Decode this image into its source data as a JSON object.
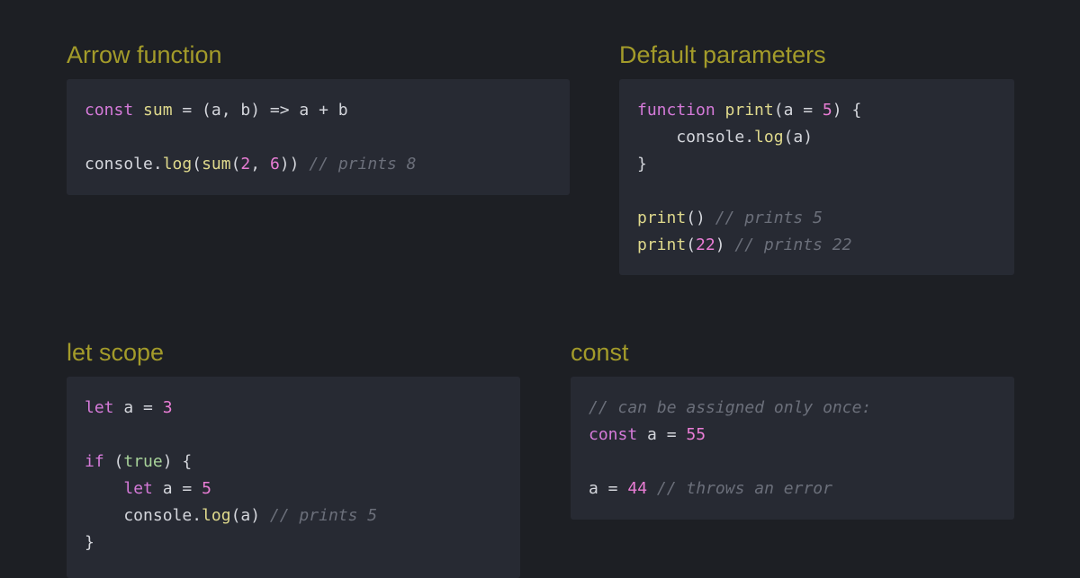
{
  "sections": [
    {
      "id": "arrow-function",
      "title": "Arrow function",
      "lines": [
        [
          {
            "t": "const",
            "k": "kw"
          },
          {
            "t": " ",
            "k": "pl"
          },
          {
            "t": "sum",
            "k": "fn"
          },
          {
            "t": " = (a, b) => a + b",
            "k": "pl"
          }
        ],
        [],
        [
          {
            "t": "console.",
            "k": "pl"
          },
          {
            "t": "log",
            "k": "fn"
          },
          {
            "t": "(",
            "k": "pl"
          },
          {
            "t": "sum",
            "k": "fn"
          },
          {
            "t": "(",
            "k": "pl"
          },
          {
            "t": "2",
            "k": "num"
          },
          {
            "t": ", ",
            "k": "pl"
          },
          {
            "t": "6",
            "k": "num"
          },
          {
            "t": ")) ",
            "k": "pl"
          },
          {
            "t": "// prints 8",
            "k": "com"
          }
        ]
      ]
    },
    {
      "id": "default-parameters",
      "title": "Default parameters",
      "lines": [
        [
          {
            "t": "function",
            "k": "kw"
          },
          {
            "t": " ",
            "k": "pl"
          },
          {
            "t": "print",
            "k": "fn"
          },
          {
            "t": "(a = ",
            "k": "pl"
          },
          {
            "t": "5",
            "k": "num"
          },
          {
            "t": ") {",
            "k": "pl"
          }
        ],
        [
          {
            "t": "    console.",
            "k": "pl"
          },
          {
            "t": "log",
            "k": "fn"
          },
          {
            "t": "(a)",
            "k": "pl"
          }
        ],
        [
          {
            "t": "}",
            "k": "pl"
          }
        ],
        [],
        [
          {
            "t": "print",
            "k": "fn"
          },
          {
            "t": "() ",
            "k": "pl"
          },
          {
            "t": "// prints 5",
            "k": "com"
          }
        ],
        [
          {
            "t": "print",
            "k": "fn"
          },
          {
            "t": "(",
            "k": "pl"
          },
          {
            "t": "22",
            "k": "num"
          },
          {
            "t": ") ",
            "k": "pl"
          },
          {
            "t": "// prints 22",
            "k": "com"
          }
        ]
      ]
    },
    {
      "id": "let-scope",
      "title": "let scope",
      "lines": [
        [
          {
            "t": "let",
            "k": "kw"
          },
          {
            "t": " a = ",
            "k": "pl"
          },
          {
            "t": "3",
            "k": "num"
          }
        ],
        [],
        [
          {
            "t": "if",
            "k": "kw"
          },
          {
            "t": " (",
            "k": "pl"
          },
          {
            "t": "true",
            "k": "str"
          },
          {
            "t": ") {",
            "k": "pl"
          }
        ],
        [
          {
            "t": "    ",
            "k": "pl"
          },
          {
            "t": "let",
            "k": "kw"
          },
          {
            "t": " a = ",
            "k": "pl"
          },
          {
            "t": "5",
            "k": "num"
          }
        ],
        [
          {
            "t": "    console.",
            "k": "pl"
          },
          {
            "t": "log",
            "k": "fn"
          },
          {
            "t": "(a) ",
            "k": "pl"
          },
          {
            "t": "// prints 5",
            "k": "com"
          }
        ],
        [
          {
            "t": "}",
            "k": "pl"
          }
        ]
      ]
    },
    {
      "id": "const",
      "title": "const",
      "lines": [
        [
          {
            "t": "// can be assigned only once:",
            "k": "com"
          }
        ],
        [
          {
            "t": "const",
            "k": "kw"
          },
          {
            "t": " a = ",
            "k": "pl"
          },
          {
            "t": "55",
            "k": "num"
          }
        ],
        [],
        [
          {
            "t": "a = ",
            "k": "pl"
          },
          {
            "t": "44",
            "k": "num"
          },
          {
            "t": " ",
            "k": "pl"
          },
          {
            "t": "// throws an error",
            "k": "com"
          }
        ]
      ]
    }
  ]
}
